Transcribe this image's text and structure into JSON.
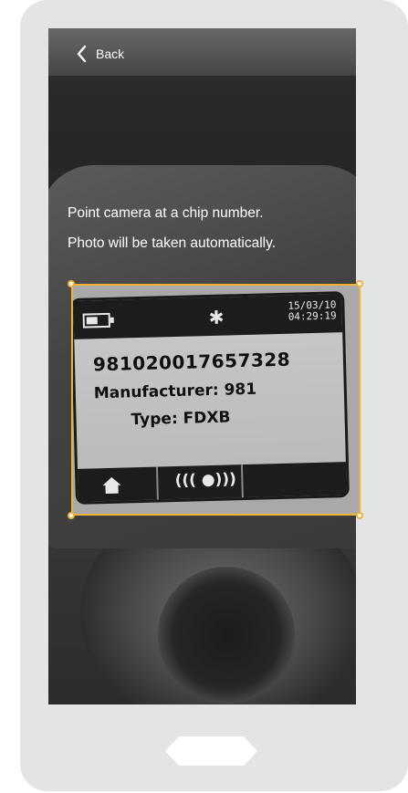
{
  "header": {
    "back_label": "Back"
  },
  "instructions": {
    "line1": "Point camera at a chip number.",
    "line2": "Photo will be taken automatically."
  },
  "camera_preview": {
    "lcd": {
      "date": "15/03/10",
      "time": "04:29:19",
      "chip_number": "981020017657328",
      "manufacturer_line": "Manufacturer: 981",
      "type_line": "Type: FDXB",
      "signal_glyph": "((( ●)))"
    }
  },
  "colors": {
    "frame_accent": "#f2b134",
    "phone_body": "#e3e4e6",
    "home_button": "#ffffff"
  },
  "icons": [
    "chevron-left-icon",
    "battery-icon",
    "bluetooth-icon",
    "home-icon",
    "signal-icon"
  ]
}
